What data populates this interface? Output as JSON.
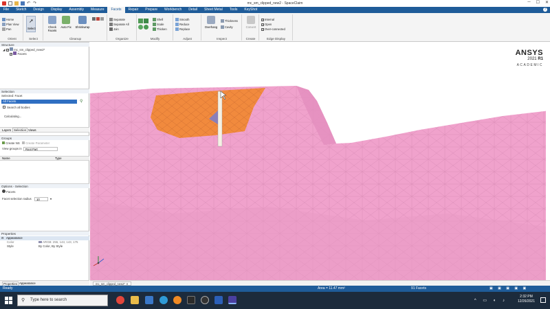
{
  "window": {
    "title": "mc_sm_clipped_new2 - SpaceClaim"
  },
  "tabs": [
    "File",
    "Sketch",
    "Design",
    "Display",
    "Assembly",
    "Measure",
    "Facets",
    "Repair",
    "Prepare",
    "Workbench",
    "Detail",
    "Sheet Metal",
    "Tools",
    "KeyShot"
  ],
  "active_tab": "Facets",
  "ribbon": {
    "groups": {
      "orient": "Orient",
      "select": "Select",
      "cleanup": "Cleanup",
      "organize": "Organize",
      "modify": "Modify",
      "adjust": "Adjust",
      "inspect": "Inspect",
      "create": "Create",
      "edge_display": "Edge Display"
    },
    "orient_items": [
      "Home",
      "Plan View",
      "Pan"
    ],
    "select_label": "Select",
    "cleanup_items": [
      "Check Facets",
      "Auto Fix",
      "Shrinkwrap"
    ],
    "organize_items": [
      "Separate",
      "Separate All",
      "Join"
    ],
    "modify_items": [
      "Shell",
      "Scale",
      "Thicken"
    ],
    "adjust_items": [
      "Smooth",
      "Reduce",
      "Replace"
    ],
    "inspect_items": [
      "Overhang",
      "Thickness",
      "Cavity"
    ],
    "create_items": [
      "Convert"
    ],
    "edge_display_items": [
      "Internal",
      "Open",
      "Over-connected"
    ]
  },
  "structure": {
    "header": "Structure",
    "root": "mc_sm_clipped_new2*",
    "child": "Facets"
  },
  "selection": {
    "header": "Selection",
    "selected_label": "Selected:",
    "selected_value": "Facet",
    "row_label": "All Facets",
    "checkbox_label": "Search all bodies",
    "status": "Calculating..."
  },
  "panel_tabs": [
    "Layers",
    "Selection",
    "Views"
  ],
  "groups": {
    "header": "Groups",
    "create_ns": "Create NS",
    "create_param": "Create Parameter",
    "view_label": "View groups in",
    "view_value": "Root Part",
    "col_name": "Name",
    "col_type": "Type"
  },
  "options": {
    "header": "Options - Selection",
    "item": "Facets",
    "field_label": "Facet selection radius",
    "field_value": "10"
  },
  "properties": {
    "header": "Properties",
    "section": "Appearance",
    "rows": [
      {
        "name": "Color",
        "value": "ARGB: 255, 143, 143, 175"
      },
      {
        "name": "Style",
        "value": "By Color, By Style"
      }
    ],
    "footer_tabs": [
      "Properties",
      "Appearance"
    ]
  },
  "logo": {
    "brand": "ANSYS",
    "version": "2021",
    "release": "R1",
    "edition": "ACADEMIC"
  },
  "doc_tab": "mc_sm_clipped_new2*",
  "status_bar": {
    "left": "Ready",
    "area": "Area = 11.47 mm²",
    "facets": "91 Facets"
  },
  "taskbar": {
    "search_placeholder": "Type here to search",
    "time": "2:32 PM",
    "date": "12/26/2021"
  },
  "colors": {
    "mesh": "#f0a2cc",
    "selection": "#f18a3d",
    "ribbon": "#1f5c99"
  }
}
